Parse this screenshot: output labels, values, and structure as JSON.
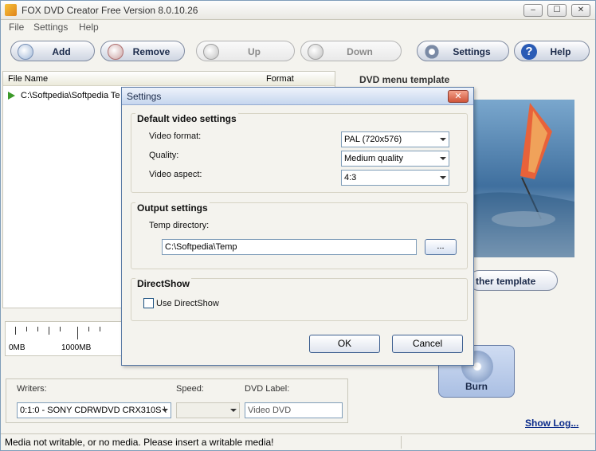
{
  "window": {
    "title": "FOX DVD Creator Free Version 8.0.10.26",
    "controls": {
      "minimize": "–",
      "maximize": "☐",
      "close": "✕"
    }
  },
  "menu": [
    "File",
    "Settings",
    "Help"
  ],
  "toolbar": {
    "add": "Add",
    "remove": "Remove",
    "up": "Up",
    "down": "Down",
    "settings": "Settings",
    "help": "Help"
  },
  "file_list": {
    "columns": [
      "File Name",
      "Format"
    ],
    "rows": [
      {
        "name": "C:\\Softpedia\\Softpedia Te"
      }
    ]
  },
  "right_panel": {
    "title": "DVD menu template",
    "other_template": "ther template",
    "burn": "Burn",
    "show_log": "Show Log..."
  },
  "size_ruler": {
    "tick_0": "0MB",
    "tick_1": "1000MB"
  },
  "writers_panel": {
    "writers_label": "Writers:",
    "speed_label": "Speed:",
    "dvd_label_label": "DVD Label:",
    "writer_value": "0:1:0 - SONY CDRWDVD CRX310S \\",
    "speed_value": "",
    "dvd_label_value": "Video DVD"
  },
  "status": {
    "message": "Media not writable, or no media. Please insert a writable media!"
  },
  "settings_dialog": {
    "title": "Settings",
    "close": "✕",
    "video_group": "Default video settings",
    "video_format_label": "Video format:",
    "video_format_value": "PAL (720x576)",
    "quality_label": "Quality:",
    "quality_value": "Medium quality",
    "aspect_label": "Video aspect:",
    "aspect_value": "4:3",
    "output_group": "Output settings",
    "temp_label": "Temp directory:",
    "temp_value": "C:\\Softpedia\\Temp",
    "browse": "...",
    "directshow_group": "DirectShow",
    "use_directshow": "Use DirectShow",
    "use_directshow_checked": false,
    "ok": "OK",
    "cancel": "Cancel"
  }
}
